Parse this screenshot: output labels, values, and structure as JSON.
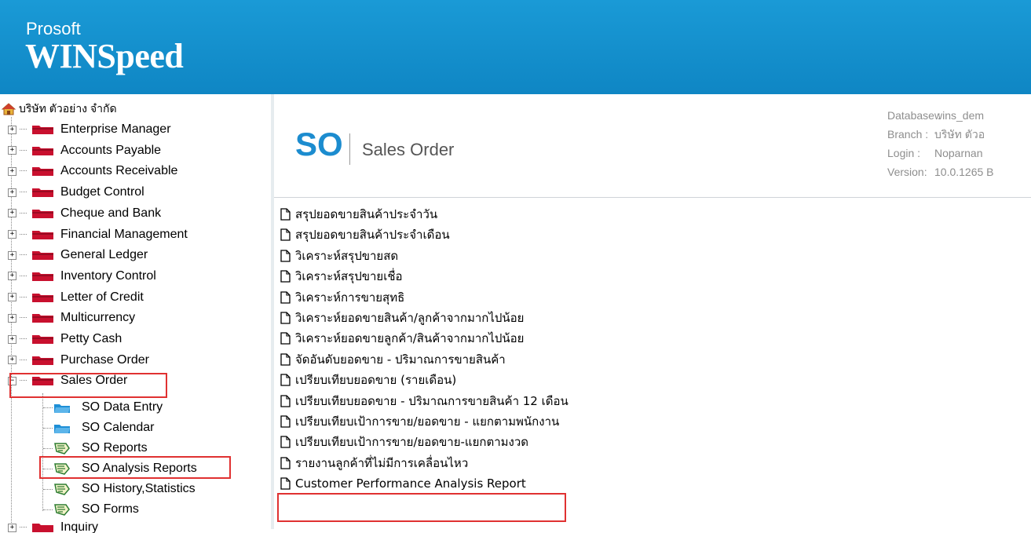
{
  "brand": {
    "small": "Prosoft",
    "big": "WINSpeed"
  },
  "tree": {
    "root_label": "บริษัท ตัวอย่าง จำกัด",
    "modules": [
      "Enterprise Manager",
      "Accounts Payable",
      "Accounts Receivable",
      "Budget Control",
      "Cheque and Bank",
      "Financial Management",
      "General Ledger",
      "Inventory Control",
      "Letter of Credit",
      "Multicurrency",
      "Petty Cash",
      "Purchase Order",
      "Sales Order"
    ],
    "sales_order_children": [
      "SO Data Entry",
      "SO Calendar",
      "SO Reports",
      "SO Analysis Reports",
      "SO History,Statistics",
      "SO Forms"
    ],
    "next_module": "Inquiry"
  },
  "header": {
    "logo": "SO",
    "title": "Sales Order",
    "info": [
      {
        "label": "Database :",
        "value": "wins_dem"
      },
      {
        "label": "Branch :",
        "value": "บริษัท ตัวอ"
      },
      {
        "label": "Login :",
        "value": "Noparnan"
      },
      {
        "label": "Version:",
        "value": "10.0.1265 B"
      }
    ]
  },
  "reports": [
    "สรุปยอดขายสินค้าประจำวัน",
    "สรุปยอดขายสินค้าประจำเดือน",
    "วิเคราะห์สรุปขายสด",
    "วิเคราะห์สรุปขายเชื่อ",
    "วิเคราะห์การขายสุทธิ",
    "วิเคราะห์ยอดขายสินค้า/ลูกค้าจากมากไปน้อย",
    "วิเคราะห์ยอดขายลูกค้า/สินค้าจากมากไปน้อย",
    "จัดอันดับยอดขาย - ปริมาณการขายสินค้า",
    "เปรียบเทียบยอดขาย (รายเดือน)",
    "เปรียบเทียบยอดขาย - ปริมาณการขายสินค้า 12 เดือน",
    "เปรียบเทียบเป้าการขาย/ยอดขาย - แยกตามพนักงาน",
    "เปรียบเทียบเป้าการขาย/ยอดขาย-แยกตามงวด",
    "รายงานลูกค้าที่ไม่มีการเคลื่อนไหว",
    "Customer Performance Analysis Report"
  ],
  "colors": {
    "banner": "#1a9ad6",
    "accent": "#1c8ccf",
    "highlight": "#e03131",
    "folder_red": "#c8102e",
    "folder_blue": "#1e8fd6"
  }
}
